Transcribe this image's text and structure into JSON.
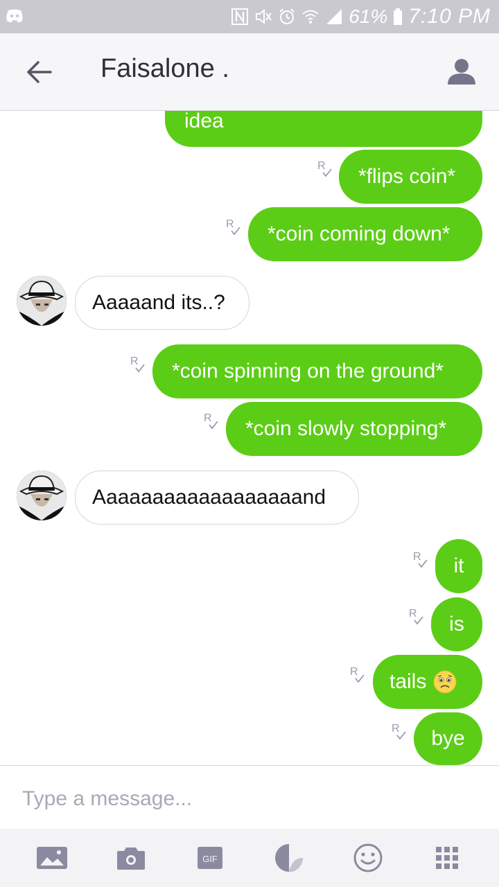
{
  "status_bar": {
    "battery": "61%",
    "time": "7:10 PM"
  },
  "header": {
    "title": "Faisalone ."
  },
  "messages": [
    {
      "side": "out",
      "text": "idea"
    },
    {
      "side": "out",
      "text": "*flips coin*"
    },
    {
      "side": "out",
      "text": "*coin coming down*"
    },
    {
      "side": "in",
      "text": "Aaaaand its..?"
    },
    {
      "side": "out",
      "text": "*coin spinning on the ground*"
    },
    {
      "side": "out",
      "text": "*coin slowly stopping*"
    },
    {
      "side": "in",
      "text": "Aaaaaaaaaaaaaaaaaand"
    },
    {
      "side": "out",
      "text": "it"
    },
    {
      "side": "out",
      "text": "is"
    },
    {
      "side": "out",
      "text": "tails"
    },
    {
      "side": "out",
      "text": "bye"
    }
  ],
  "read_receipt": "R",
  "input": {
    "placeholder": "Type a message..."
  },
  "toolbar": {
    "gif_label": "GIF",
    "icons": [
      "image-icon",
      "camera-icon",
      "gif-icon",
      "sticker-icon",
      "emoji-icon",
      "apps-grid-icon"
    ]
  },
  "colors": {
    "outgoing_bubble": "#5ccd16",
    "incoming_bubble_border": "#d6d6dc",
    "header_bg": "#f6f6f8",
    "status_bar_bg": "#c9c9cf"
  }
}
